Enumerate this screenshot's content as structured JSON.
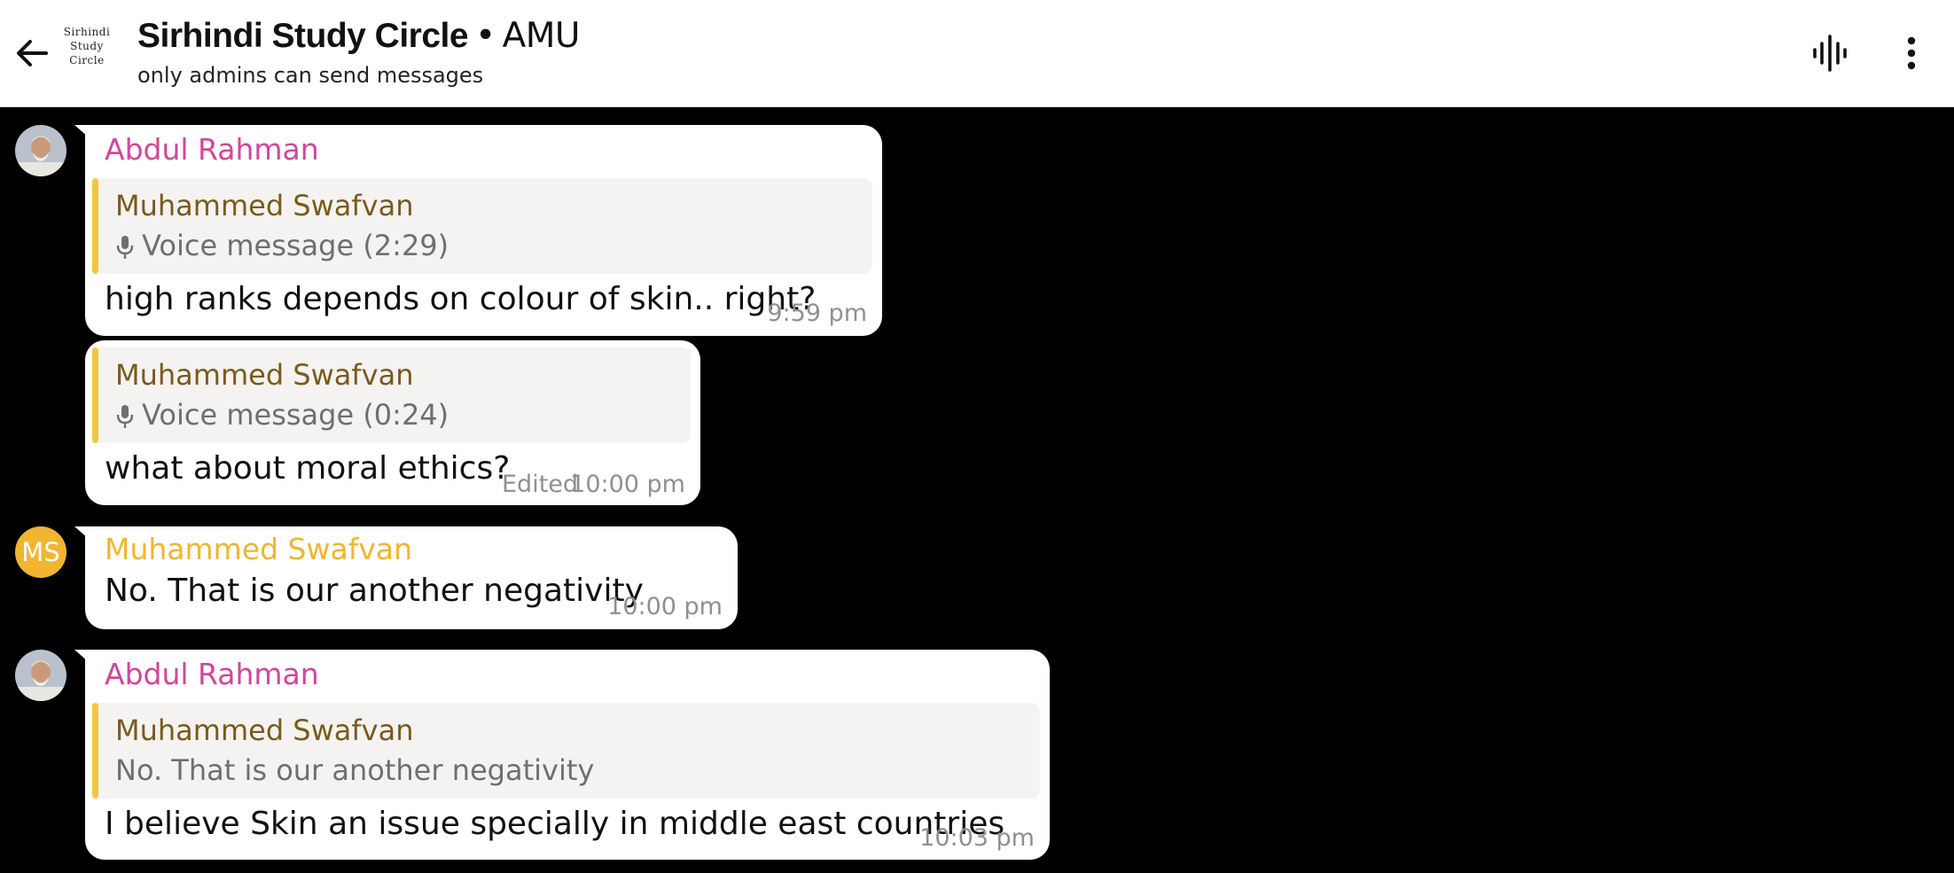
{
  "header": {
    "logo_lines": [
      "Sirhindi",
      "Study",
      "Circle"
    ],
    "title": "Sirhindi Study Circle",
    "separator": "•",
    "org": "AMU",
    "subtitle": "only admins can send messages"
  },
  "messages": [
    {
      "sender": "Abdul Rahman",
      "reply_to": {
        "name": "Muhammed Swafvan",
        "text": "Voice message (2:29)"
      },
      "text": "high ranks depends on colour of skin.. right?",
      "time": "9:59 pm"
    },
    {
      "reply_to": {
        "name": "Muhammed Swafvan",
        "text": "Voice message (0:24)"
      },
      "text": "what about moral ethics?",
      "edited": "Edited",
      "time": "10:00 pm"
    },
    {
      "avatar_initials": "MS",
      "sender": "Muhammed Swafvan",
      "text": "No. That is our another negativity",
      "time": "10:00 pm"
    },
    {
      "sender": "Abdul Rahman",
      "reply_to": {
        "name": "Muhammed Swafvan",
        "text": "No. That is our another negativity"
      },
      "text": "I believe Skin an issue specially in middle east countries",
      "time": "10:03 pm"
    }
  ],
  "colors": {
    "background": "#000000",
    "bubble": "#ffffff",
    "sender_abdul": "#d0479a",
    "sender_swafvan": "#f2b531",
    "reply_name": "#7a5a1c",
    "reply_bar": "#f4c542",
    "timestamp": "#8d9094"
  },
  "icons": [
    "back-arrow-icon",
    "voice-chat-icon",
    "more-vertical-icon",
    "microphone-icon"
  ]
}
